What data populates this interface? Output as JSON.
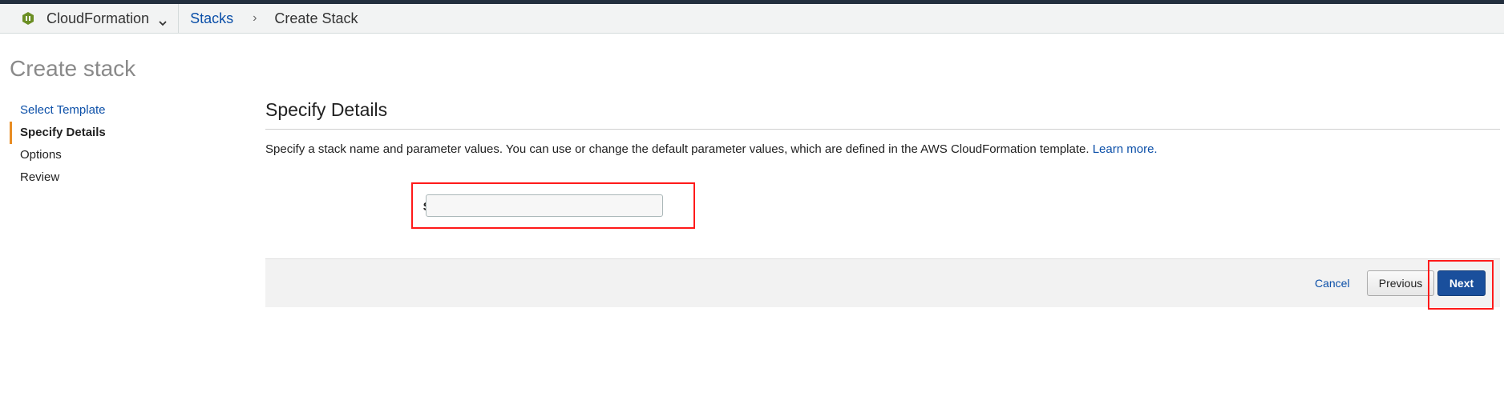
{
  "header": {
    "service_name": "CloudFormation",
    "service_icon": "cloudformation-icon",
    "breadcrumb": {
      "stacks_label": "Stacks",
      "separator": "›",
      "current_label": "Create Stack"
    }
  },
  "page": {
    "title": "Create stack"
  },
  "wizard_nav": {
    "steps": [
      {
        "label": "Select Template",
        "state": "link"
      },
      {
        "label": "Specify Details",
        "state": "active"
      },
      {
        "label": "Options",
        "state": "inactive"
      },
      {
        "label": "Review",
        "state": "inactive"
      }
    ]
  },
  "details": {
    "title": "Specify Details",
    "description": "Specify a stack name and parameter values. You can use or change the default parameter values, which are defined in the AWS CloudFormation template.",
    "learn_more": "Learn more.",
    "stack_name_label": "Stack name",
    "stack_name_value": "",
    "stack_name_placeholder": ""
  },
  "footer": {
    "cancel_label": "Cancel",
    "previous_label": "Previous",
    "next_label": "Next"
  },
  "colors": {
    "link": "#0b4fa8",
    "active_step_marker": "#e88d24",
    "primary_button": "#1a4f9c",
    "highlight": "#ff1a1a"
  }
}
